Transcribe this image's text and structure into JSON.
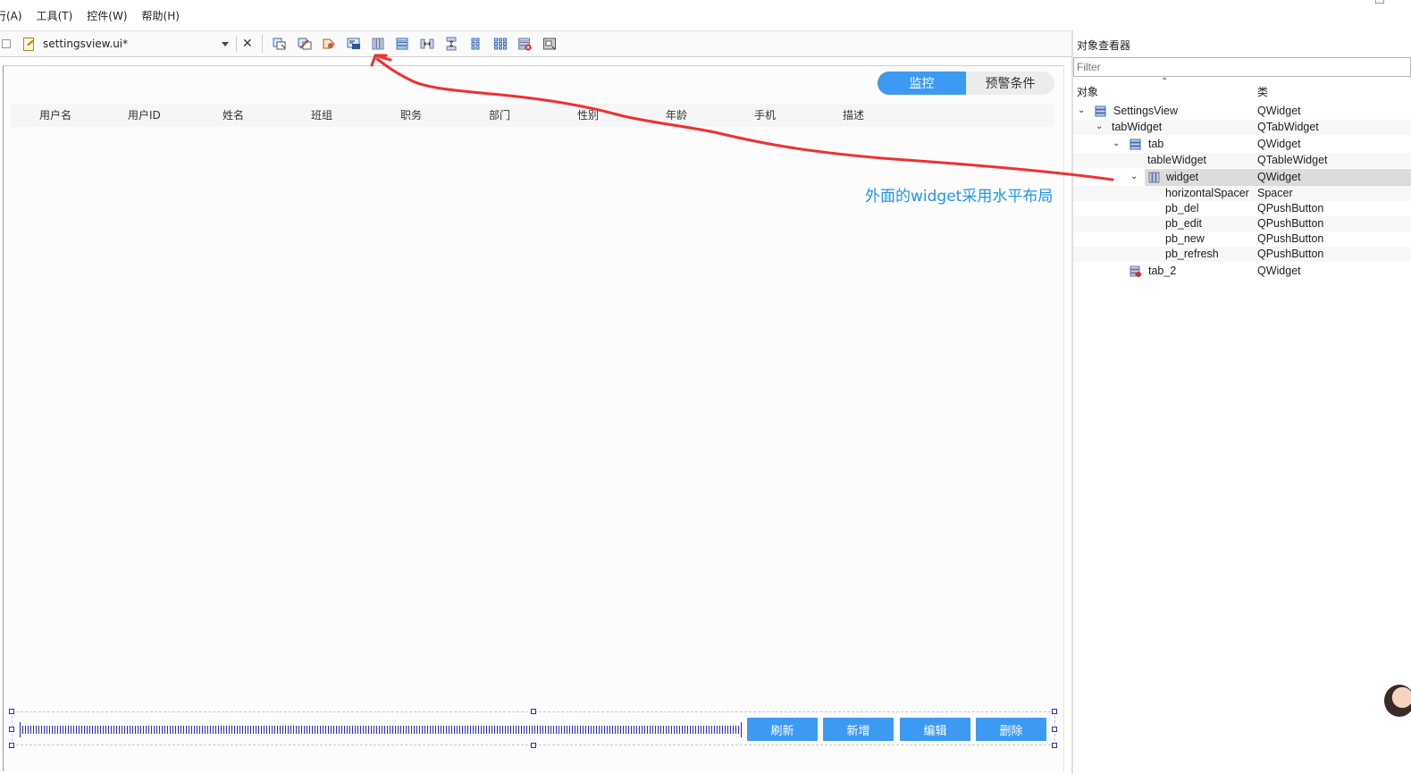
{
  "menu": [
    "行(A)",
    "工具(T)",
    "控件(W)",
    "帮助(H)"
  ],
  "toolbar": {
    "file_name": "settingsview.ui*",
    "icons": [
      "edit-widgets-icon",
      "edit-signals-icon",
      "edit-buddies-icon",
      "edit-tab-order-icon",
      "horizontal-layout-icon",
      "vertical-layout-icon",
      "splitter-horizontal-icon",
      "splitter-vertical-icon",
      "form-layout-icon",
      "grid-layout-icon",
      "break-layout-icon",
      "adjust-size-icon"
    ]
  },
  "canvas": {
    "tabs": [
      "监控",
      "预警条件"
    ],
    "table_headers": [
      "用户名",
      "用户ID",
      "姓名",
      "班组",
      "职务",
      "部门",
      "性别",
      "年龄",
      "手机",
      "描述"
    ],
    "buttons": [
      "刷新",
      "新增",
      "编辑",
      "删除"
    ]
  },
  "annotation": {
    "text": "外面的widget采用水平布局",
    "color": "#f03030",
    "text_color": "#2196e8"
  },
  "inspector": {
    "title": "对象查看器",
    "filter_placeholder": "Filter",
    "col_object": "对象",
    "col_class": "类",
    "rows": [
      {
        "name": "SettingsView",
        "class": "QWidget",
        "expanded": true,
        "icon": "vertical-layout-icon"
      },
      {
        "name": "tabWidget",
        "class": "QTabWidget",
        "expanded": true,
        "icon": ""
      },
      {
        "name": "tab",
        "class": "QWidget",
        "expanded": true,
        "icon": "vertical-layout-icon"
      },
      {
        "name": "tableWidget",
        "class": "QTableWidget",
        "expanded": false,
        "icon": ""
      },
      {
        "name": "widget",
        "class": "QWidget",
        "expanded": true,
        "icon": "horizontal-layout-icon",
        "selected": true
      },
      {
        "name": "horizontalSpacer",
        "class": "Spacer",
        "expanded": false,
        "icon": ""
      },
      {
        "name": "pb_del",
        "class": "QPushButton",
        "expanded": false,
        "icon": ""
      },
      {
        "name": "pb_edit",
        "class": "QPushButton",
        "expanded": false,
        "icon": ""
      },
      {
        "name": "pb_new",
        "class": "QPushButton",
        "expanded": false,
        "icon": ""
      },
      {
        "name": "pb_refresh",
        "class": "QPushButton",
        "expanded": false,
        "icon": ""
      },
      {
        "name": "tab_2",
        "class": "QWidget",
        "expanded": false,
        "icon": "break-layout-icon"
      }
    ]
  },
  "colors": {
    "accent": "#3d9af2",
    "selection": "#dcdcdc"
  }
}
